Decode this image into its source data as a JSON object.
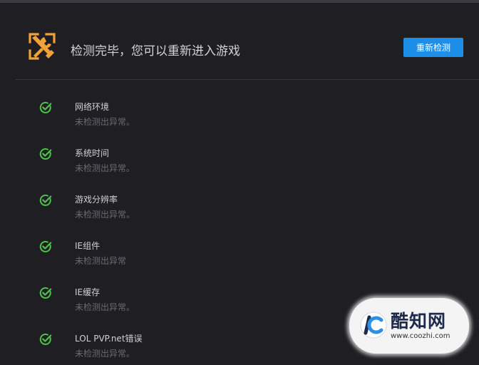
{
  "header": {
    "title": "检测完毕，您可以重新进入游戏",
    "recheck_label": "重新检测",
    "icon": "wrench-tools-icon",
    "icon_color": "#f0a13a"
  },
  "items": [
    {
      "name": "网络环境",
      "status": "未检测出异常。"
    },
    {
      "name": "系统时间",
      "status": "未检测出异常。"
    },
    {
      "name": "游戏分辨率",
      "status": "未检测出异常。"
    },
    {
      "name": "IE组件",
      "status": "未检测出异常"
    },
    {
      "name": "IE缓存",
      "status": "未检测出异常。"
    },
    {
      "name": "LOL PVP.net错误",
      "status": "未检测出异常。"
    }
  ],
  "watermark": {
    "name": "酷知网",
    "url": "www.coozhi.com"
  },
  "colors": {
    "background": "#1f1f23",
    "accent": "#1e8fe8",
    "check": "#4cc24a",
    "tool_icon": "#f0a13a"
  }
}
